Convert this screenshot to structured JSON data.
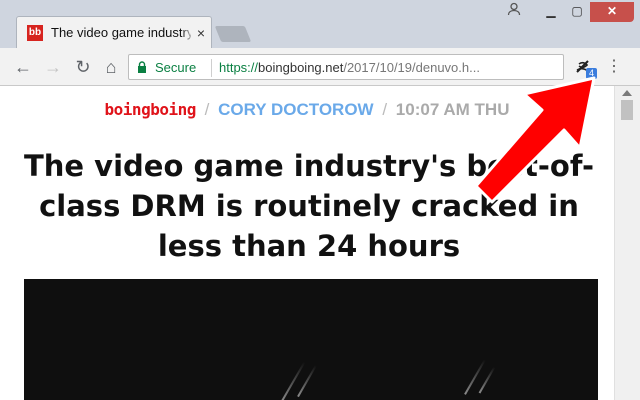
{
  "tab": {
    "favicon": "bb",
    "title": "The video game industry's best-of-class",
    "close": "×"
  },
  "window": {
    "minimize": "▁",
    "maximize": "▢",
    "close": "✕",
    "user": "👤"
  },
  "toolbar": {
    "back": "←",
    "forward": "→",
    "reload": "↻",
    "home": "⌂",
    "secure_label": "Secure",
    "url_scheme": "https://",
    "url_host": "boingboing.net",
    "url_path": "/2017/10/19/denuvo.h...",
    "extension_badge": "4",
    "menu": "⋮"
  },
  "page": {
    "logo": "boingboing",
    "separator": "/",
    "author": "CORY DOCTOROW",
    "time": "10:07 AM THU",
    "headline": "The video game industry's best-of-class DRM is routinely cracked in less than 24 hours"
  },
  "icons": [
    "bb-favicon-icon",
    "close-icon",
    "minimize-icon",
    "maximize-icon",
    "back-arrow-icon",
    "forward-arrow-icon",
    "reload-icon",
    "home-icon",
    "lock-icon",
    "extension-icon",
    "kebab-menu-icon",
    "red-arrow-annotation"
  ],
  "colors": {
    "accent_red": "#e0131a",
    "author_blue": "#6aa9e9",
    "secure_green": "#0b8043",
    "badge_blue": "#3b7ddd"
  }
}
